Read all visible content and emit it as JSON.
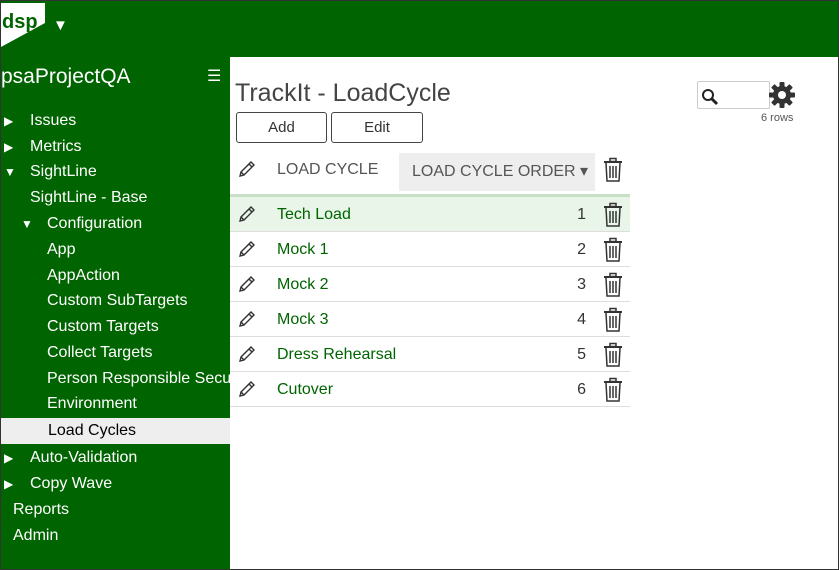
{
  "header": {
    "logo_text": "dsp",
    "menu_caret": "▼"
  },
  "sidebar": {
    "title": "psaProjectQA",
    "menu_glyph": "☰",
    "items": [
      {
        "label": "Issues",
        "arrow": "▶"
      },
      {
        "label": "Metrics",
        "arrow": "▶"
      },
      {
        "label": "SightLine",
        "arrow": "▼"
      },
      {
        "label": "SightLine - Base",
        "arrow": ""
      },
      {
        "label": "Configuration",
        "arrow": "▼"
      },
      {
        "label": "App",
        "arrow": ""
      },
      {
        "label": "AppAction",
        "arrow": ""
      },
      {
        "label": "Custom SubTargets",
        "arrow": ""
      },
      {
        "label": "Custom Targets",
        "arrow": ""
      },
      {
        "label": "Collect Targets",
        "arrow": ""
      },
      {
        "label": "Person Responsible Security",
        "arrow": ""
      },
      {
        "label": "Environment",
        "arrow": ""
      },
      {
        "label": "Load Cycles",
        "arrow": ""
      },
      {
        "label": "Auto-Validation",
        "arrow": "▶"
      },
      {
        "label": "Copy Wave",
        "arrow": "▶"
      },
      {
        "label": "Reports",
        "arrow": ""
      },
      {
        "label": "Admin",
        "arrow": ""
      }
    ]
  },
  "main": {
    "title": "TrackIt - LoadCycle",
    "buttons": {
      "add": "Add",
      "edit": "Edit"
    },
    "rows_count": "6 rows",
    "table": {
      "columns": {
        "name": "LOAD CYCLE",
        "order": "LOAD CYCLE ORDER ▾"
      },
      "rows": [
        {
          "name": "Tech Load",
          "order": "1"
        },
        {
          "name": "Mock 1",
          "order": "2"
        },
        {
          "name": "Mock 2",
          "order": "3"
        },
        {
          "name": "Mock 3",
          "order": "4"
        },
        {
          "name": "Dress Rehearsal",
          "order": "5"
        },
        {
          "name": "Cutover",
          "order": "6"
        }
      ]
    }
  },
  "colors": {
    "brand_green": "#006400",
    "active_item_bg": "#eeeeee",
    "selected_row_bg": "#e8f5e8"
  }
}
